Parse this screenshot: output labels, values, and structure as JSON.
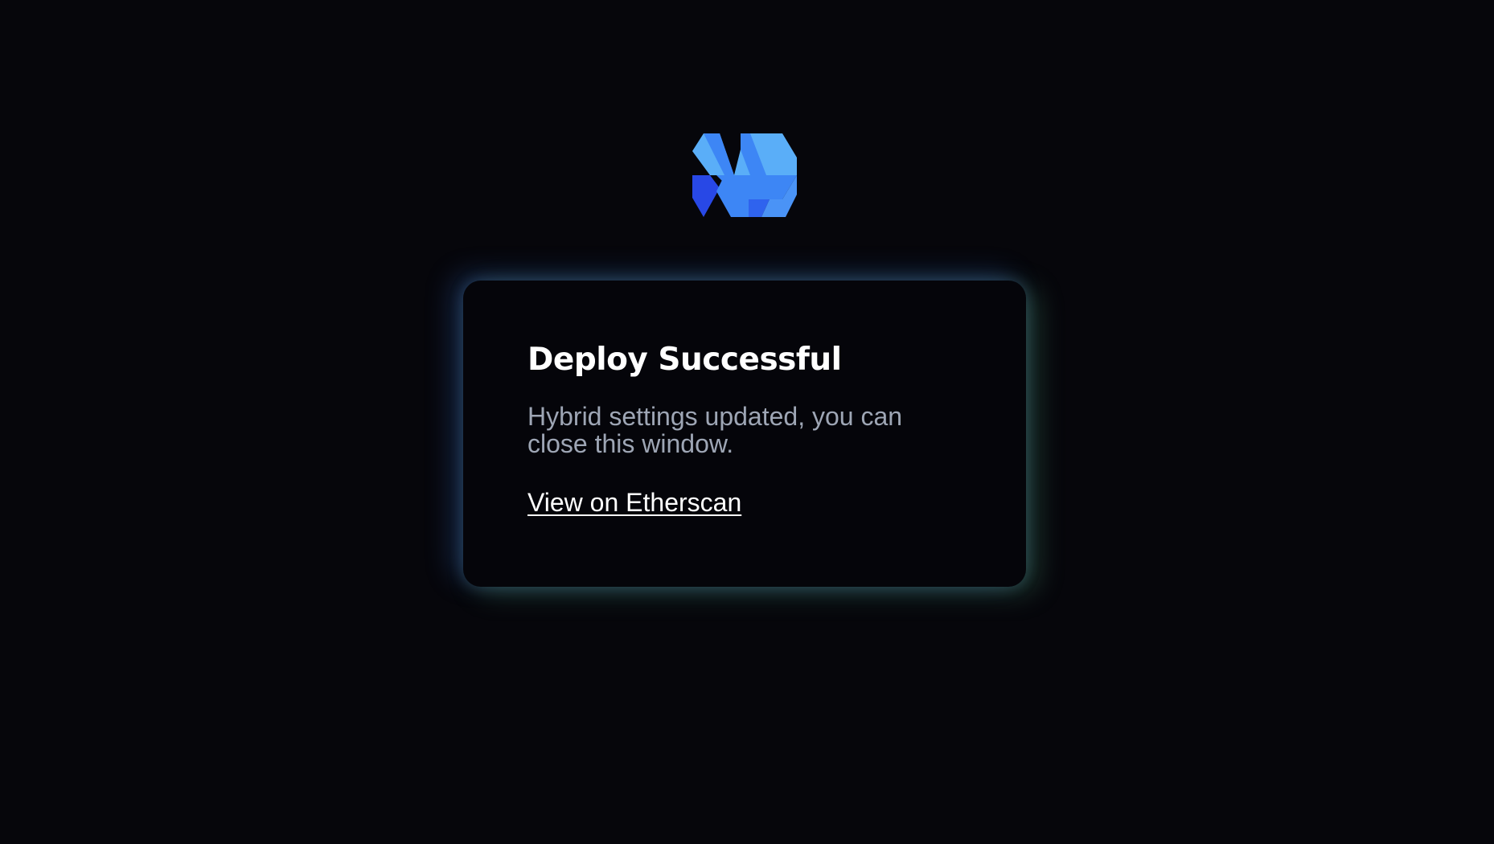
{
  "logo": {
    "icon": "hybrid-h-logo-icon",
    "colors": {
      "light": "#5aaef8",
      "mid": "#3d86f5",
      "dark": "#2848e6"
    }
  },
  "card": {
    "title": "Deploy Successful",
    "message": "Hybrid settings updated, you can close this window.",
    "link_label": "View on Etherscan",
    "glow_colors": [
      "#4682eb",
      "#69cd96"
    ]
  },
  "colors": {
    "background": "#06060b",
    "card_background": "#05050a",
    "title": "#ffffff",
    "message": "#9ea6b5",
    "link": "#ffffff"
  }
}
